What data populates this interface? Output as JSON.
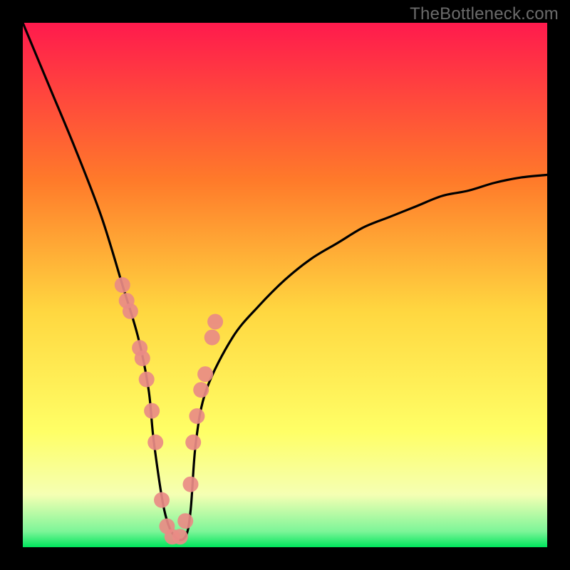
{
  "attribution": "TheBottleneck.com",
  "chart_data": {
    "type": "line",
    "title": "",
    "xlabel": "",
    "ylabel": "",
    "ylim": [
      0,
      100
    ],
    "xlim": [
      0,
      100
    ],
    "annotations": [],
    "series": [
      {
        "name": "bottleneck-curve",
        "x": [
          0,
          5,
          10,
          15,
          19,
          22,
          24,
          25,
          27,
          29,
          31,
          32,
          33,
          35,
          40,
          45,
          50,
          55,
          60,
          65,
          70,
          75,
          80,
          85,
          90,
          95,
          100
        ],
        "y": [
          100,
          88,
          76,
          63,
          50,
          40,
          30,
          20,
          7,
          2,
          2,
          7,
          20,
          30,
          40,
          46,
          51,
          55,
          58,
          61,
          63,
          65,
          67,
          68,
          69.5,
          70.5,
          71
        ]
      }
    ],
    "highlight_points": {
      "name": "data-markers",
      "x": [
        19.0,
        19.8,
        20.5,
        22.3,
        22.8,
        23.6,
        24.6,
        25.3,
        26.5,
        27.5,
        28.5,
        30.0,
        31.0,
        32.0,
        32.5,
        33.2,
        34.0,
        34.8,
        36.1,
        36.7
      ],
      "y": [
        50,
        47,
        45,
        38,
        36,
        32,
        26,
        20,
        9,
        4,
        2,
        2,
        5,
        12,
        20,
        25,
        30,
        33,
        40,
        43
      ]
    },
    "gradient": {
      "top": "#ff1a4d",
      "mid_upper": "#ff7a2a",
      "mid": "#ffd740",
      "mid_lower": "#ffff66",
      "band": "#f5ffb3",
      "bottom": "#00e55c"
    }
  }
}
